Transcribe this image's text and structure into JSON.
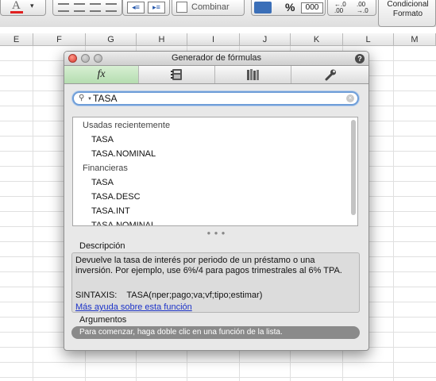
{
  "ribbon": {
    "merge_label": "Combinar",
    "percent_label": "%",
    "thousands_label": "000",
    "conditional_format_line1": "Condicional",
    "conditional_format_line2": "Formato",
    "font_color_glyph": "A"
  },
  "sheet": {
    "columns": [
      "E",
      "F",
      "G",
      "H",
      "I",
      "J",
      "K",
      "L",
      "M"
    ]
  },
  "dialog": {
    "title": "Generador de fórmulas",
    "tabs": [
      {
        "icon": "fx-icon",
        "label": "fx",
        "active": true
      },
      {
        "icon": "function-book-icon",
        "label": ""
      },
      {
        "icon": "library-icon",
        "label": ""
      },
      {
        "icon": "wrench-icon",
        "label": ""
      }
    ],
    "search": {
      "value": "TASA"
    },
    "list": [
      {
        "type": "category",
        "label": "Usadas recientemente"
      },
      {
        "type": "function",
        "label": "TASA"
      },
      {
        "type": "function",
        "label": "TASA.NOMINAL"
      },
      {
        "type": "category",
        "label": "Financieras"
      },
      {
        "type": "function",
        "label": "TASA"
      },
      {
        "type": "function",
        "label": "TASA.DESC"
      },
      {
        "type": "function",
        "label": "TASA.INT"
      },
      {
        "type": "function",
        "label": "TASA.NOMINAL"
      }
    ],
    "description": {
      "heading": "Descripción",
      "text": "Devuelve la tasa de interés por periodo de un préstamo o una inversión. Por ejemplo, use 6%/4 para pagos trimestrales al 6% TPA.",
      "syntax_label": "SINTAXIS:",
      "syntax_value": "TASA(nper;pago;va;vf;tipo;estimar)",
      "help_link": "Más ayuda sobre esta función"
    },
    "arguments": {
      "heading": "Argumentos",
      "hint": "Para comenzar, haga doble clic en una función de la lista."
    }
  },
  "colors": {
    "accent": "#6f9ed8",
    "active_tab": "#c3e6bd",
    "link": "#1b32c8",
    "close_button": "#d8342a"
  }
}
